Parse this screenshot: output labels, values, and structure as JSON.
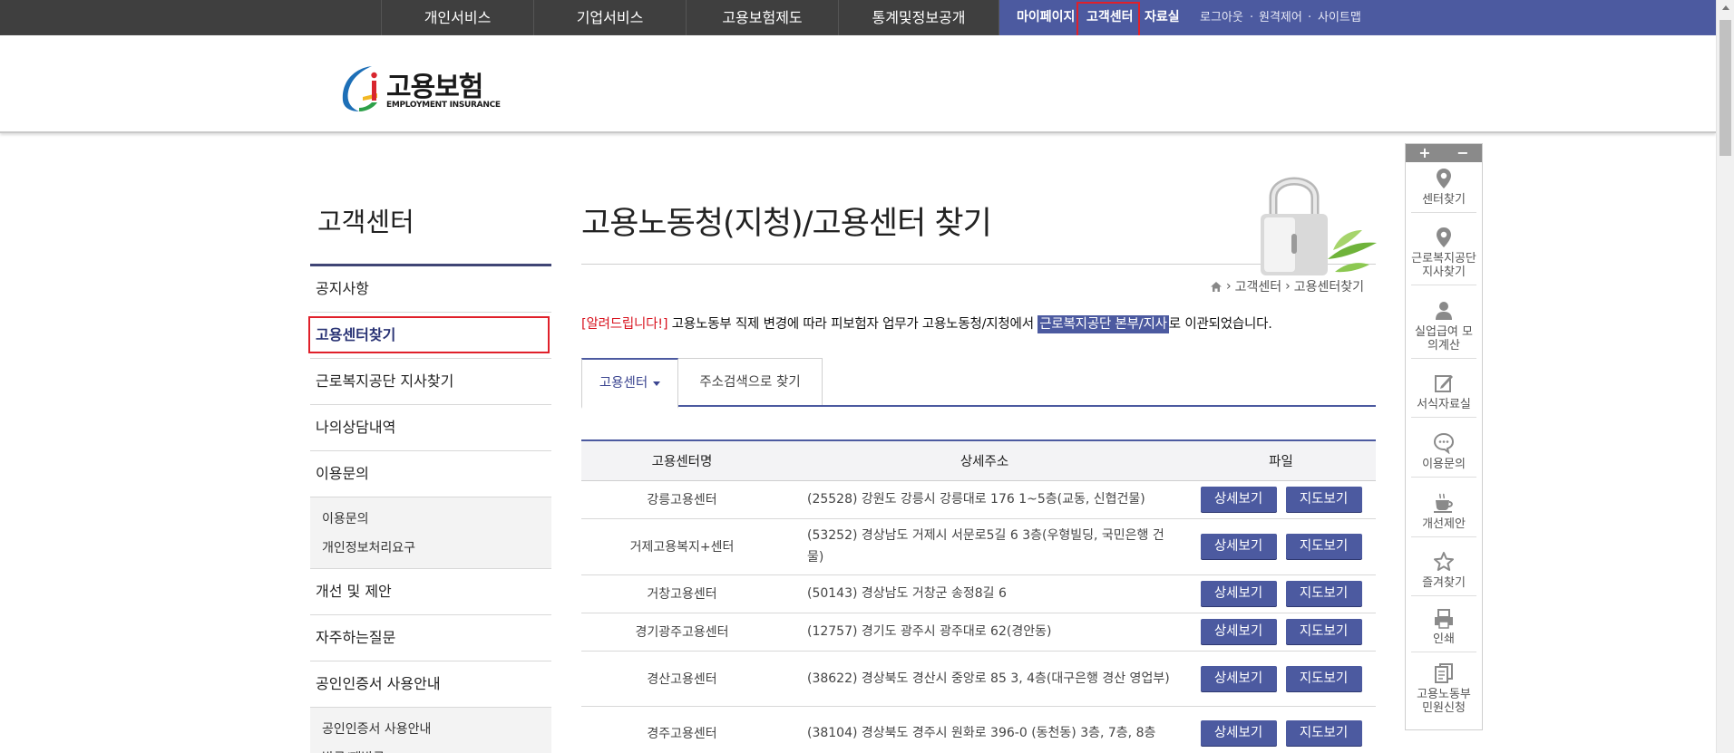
{
  "topnav": {
    "main_items": [
      "개인서비스",
      "기업서비스",
      "고용보험제도",
      "통계및정보공개"
    ],
    "my_page": "마이페이지",
    "customer_center": "고객센터",
    "data_room": "자료실",
    "logout": "로그아웃",
    "remote": "원격제어",
    "sitemap": "사이트맵"
  },
  "logo": {
    "name": "고용보험",
    "subtitle": "EMPLOYMENT INSURANCE"
  },
  "sidebar": {
    "title": "고객센터",
    "items": [
      {
        "label": "공지사항"
      },
      {
        "label": "고용센터찾기"
      },
      {
        "label": "근로복지공단 지사찾기"
      },
      {
        "label": "나의상담내역"
      },
      {
        "label": "이용문의"
      },
      {
        "label": "개선 및 제안"
      },
      {
        "label": "자주하는질문"
      },
      {
        "label": "공인인증서 사용안내"
      }
    ],
    "sub_inquiry": [
      "이용문의",
      "개인정보처리요구"
    ],
    "sub_cert": [
      "공인인증서 사용안내",
      "발급/재발급"
    ]
  },
  "main": {
    "title": "고용노동청(지청)/고용센터 찾기",
    "breadcrumb": [
      "고객센터",
      "고용센터찾기"
    ],
    "notice": {
      "alert": "[알려드립니다!]",
      "text1": " 고용노동부 직제 변경에 따라 피보험자 업무가 고용노동청/지청에서 ",
      "highlight": "근로복지공단 본부/지사",
      "text2": "로 이관되었습니다."
    },
    "tabs": [
      "고용센터",
      "주소검색으로 찾기"
    ]
  },
  "table": {
    "headers": [
      "고용센터명",
      "상세주소",
      "파일"
    ],
    "detail_label": "상세보기",
    "map_label": "지도보기",
    "rows": [
      {
        "name": "강릉고용센터",
        "addr": "(25528) 강원도 강릉시 강릉대로 176 1~5층(교동, 신협건물)"
      },
      {
        "name": "거제고용복지+센터",
        "addr": "(53252) 경상남도 거제시 서문로5길 6 3층(우형빌딩, 국민은행 건물)"
      },
      {
        "name": "거창고용센터",
        "addr": "(50143) 경상남도 거창군 송정8길 6"
      },
      {
        "name": "경기광주고용센터",
        "addr": "(12757) 경기도 광주시 광주대로 62(경안동)"
      },
      {
        "name": "경산고용센터",
        "addr": "(38622) 경상북도 경산시 중앙로 85 3, 4층(대구은행 경산 영업부)"
      },
      {
        "name": "경주고용센터",
        "addr": "(38104) 경상북도 경주시 원화로 396-0 (동천동) 3층, 7층, 8층"
      }
    ]
  },
  "quick": {
    "plus": "+",
    "minus": "−",
    "items": [
      {
        "label": "센터찾기",
        "icon": "map-pin-icon"
      },
      {
        "label": "근로복지공단 지사찾기",
        "icon": "map-pin-icon"
      },
      {
        "label": "실업급여 모의계산",
        "icon": "person-icon"
      },
      {
        "label": "서식자료실",
        "icon": "edit-icon"
      },
      {
        "label": "이용문의",
        "icon": "chat-icon"
      },
      {
        "label": "개선제안",
        "icon": "coffee-icon"
      },
      {
        "label": "즐겨찾기",
        "icon": "star-icon"
      },
      {
        "label": "인쇄",
        "icon": "print-icon"
      },
      {
        "label": "고용노동부 민원신청",
        "icon": "documents-icon"
      }
    ]
  }
}
